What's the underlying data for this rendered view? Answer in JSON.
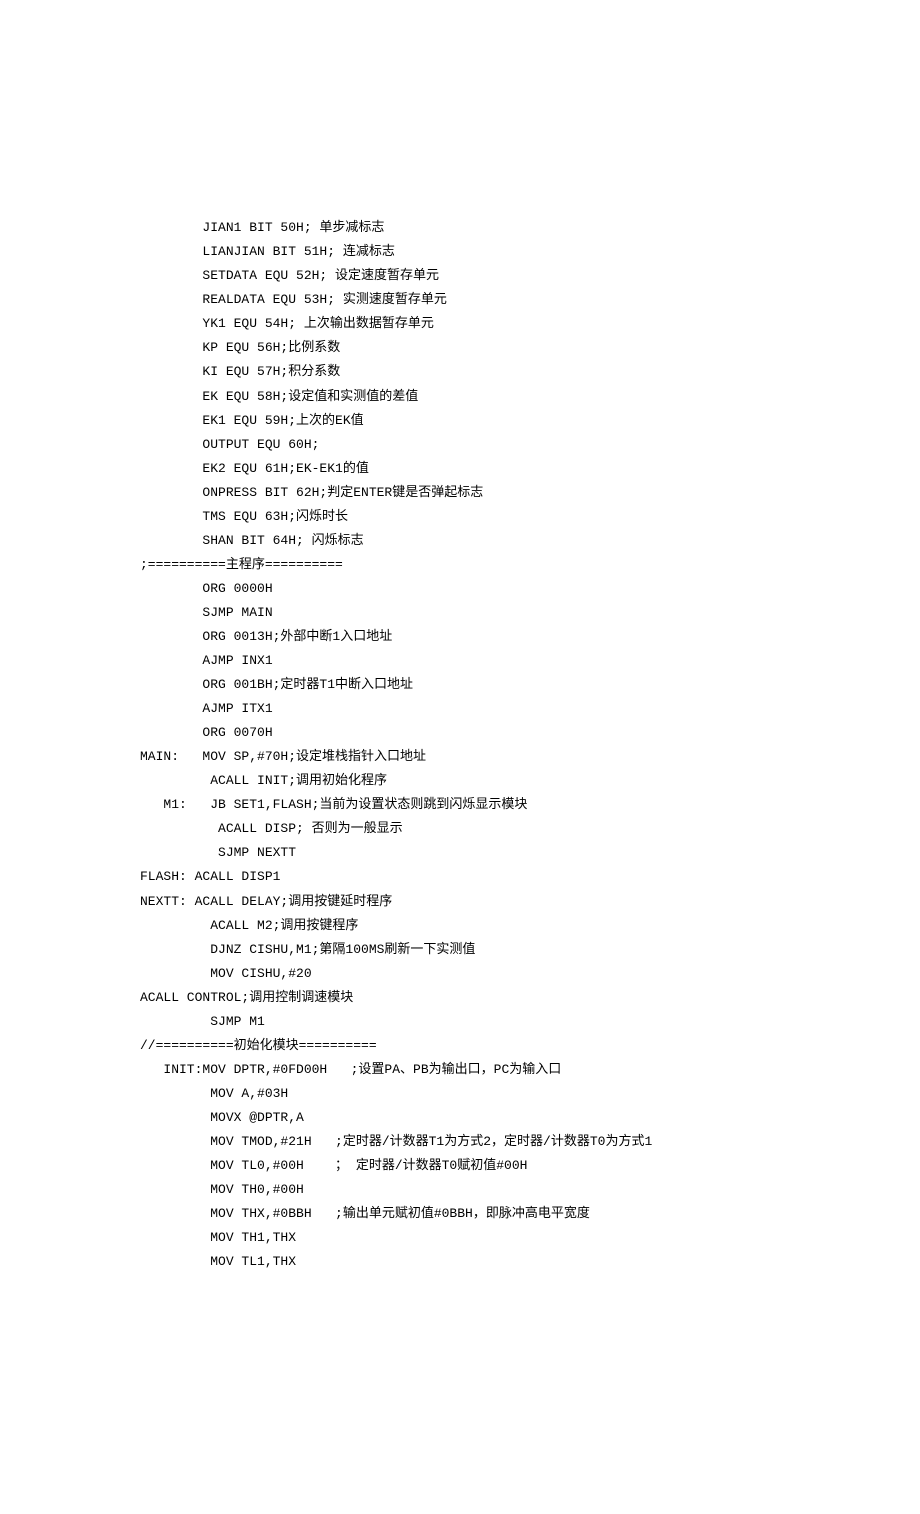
{
  "lines": [
    "        JIAN1 BIT 50H; 单步减标志",
    "        LIANJIAN BIT 51H; 连减标志",
    "        SETDATA EQU 52H; 设定速度暂存单元",
    "        REALDATA EQU 53H; 实测速度暂存单元",
    "        YK1 EQU 54H; 上次输出数据暂存单元",
    "        KP EQU 56H;比例系数",
    "        KI EQU 57H;积分系数",
    "        EK EQU 58H;设定值和实测值的差值",
    "        EK1 EQU 59H;上次的EK值",
    "        OUTPUT EQU 60H;",
    "        EK2 EQU 61H;EK-EK1的值",
    "        ONPRESS BIT 62H;判定ENTER键是否弹起标志",
    "        TMS EQU 63H;闪烁时长",
    "        SHAN BIT 64H; 闪烁标志",
    ";==========主程序==========",
    "        ORG 0000H",
    "        SJMP MAIN",
    "        ORG 0013H;外部中断1入口地址",
    "        AJMP INX1",
    "        ORG 001BH;定时器T1中断入口地址",
    "        AJMP ITX1",
    "        ORG 0070H",
    "MAIN:   MOV SP,#70H;设定堆栈指针入口地址",
    "         ACALL INIT;调用初始化程序",
    "   M1:   JB SET1,FLASH;当前为设置状态则跳到闪烁显示模块",
    "          ACALL DISP; 否则为一般显示",
    "          SJMP NEXTT",
    "FLASH: ACALL DISP1",
    "NEXTT: ACALL DELAY;调用按键延时程序",
    "         ACALL M2;调用按键程序",
    "         DJNZ CISHU,M1;第隔100MS刷新一下实测值",
    "         MOV CISHU,#20",
    "ACALL CONTROL;调用控制调速模块",
    "         SJMP M1",
    "//==========初始化模块==========",
    "   INIT:MOV DPTR,#0FD00H   ;设置PA、PB为输出口，PC为输入口",
    "         MOV A,#03H",
    "         MOVX @DPTR,A",
    "         MOV TMOD,#21H   ;定时器/计数器T1为方式2，定时器/计数器T0为方式1",
    "         MOV TL0,#00H    ； 定时器/计数器T0赋初值#00H",
    "         MOV TH0,#00H",
    "         MOV THX,#0BBH   ;输出单元赋初值#0BBH，即脉冲高电平宽度",
    "         MOV TH1,THX",
    "         MOV TL1,THX"
  ]
}
